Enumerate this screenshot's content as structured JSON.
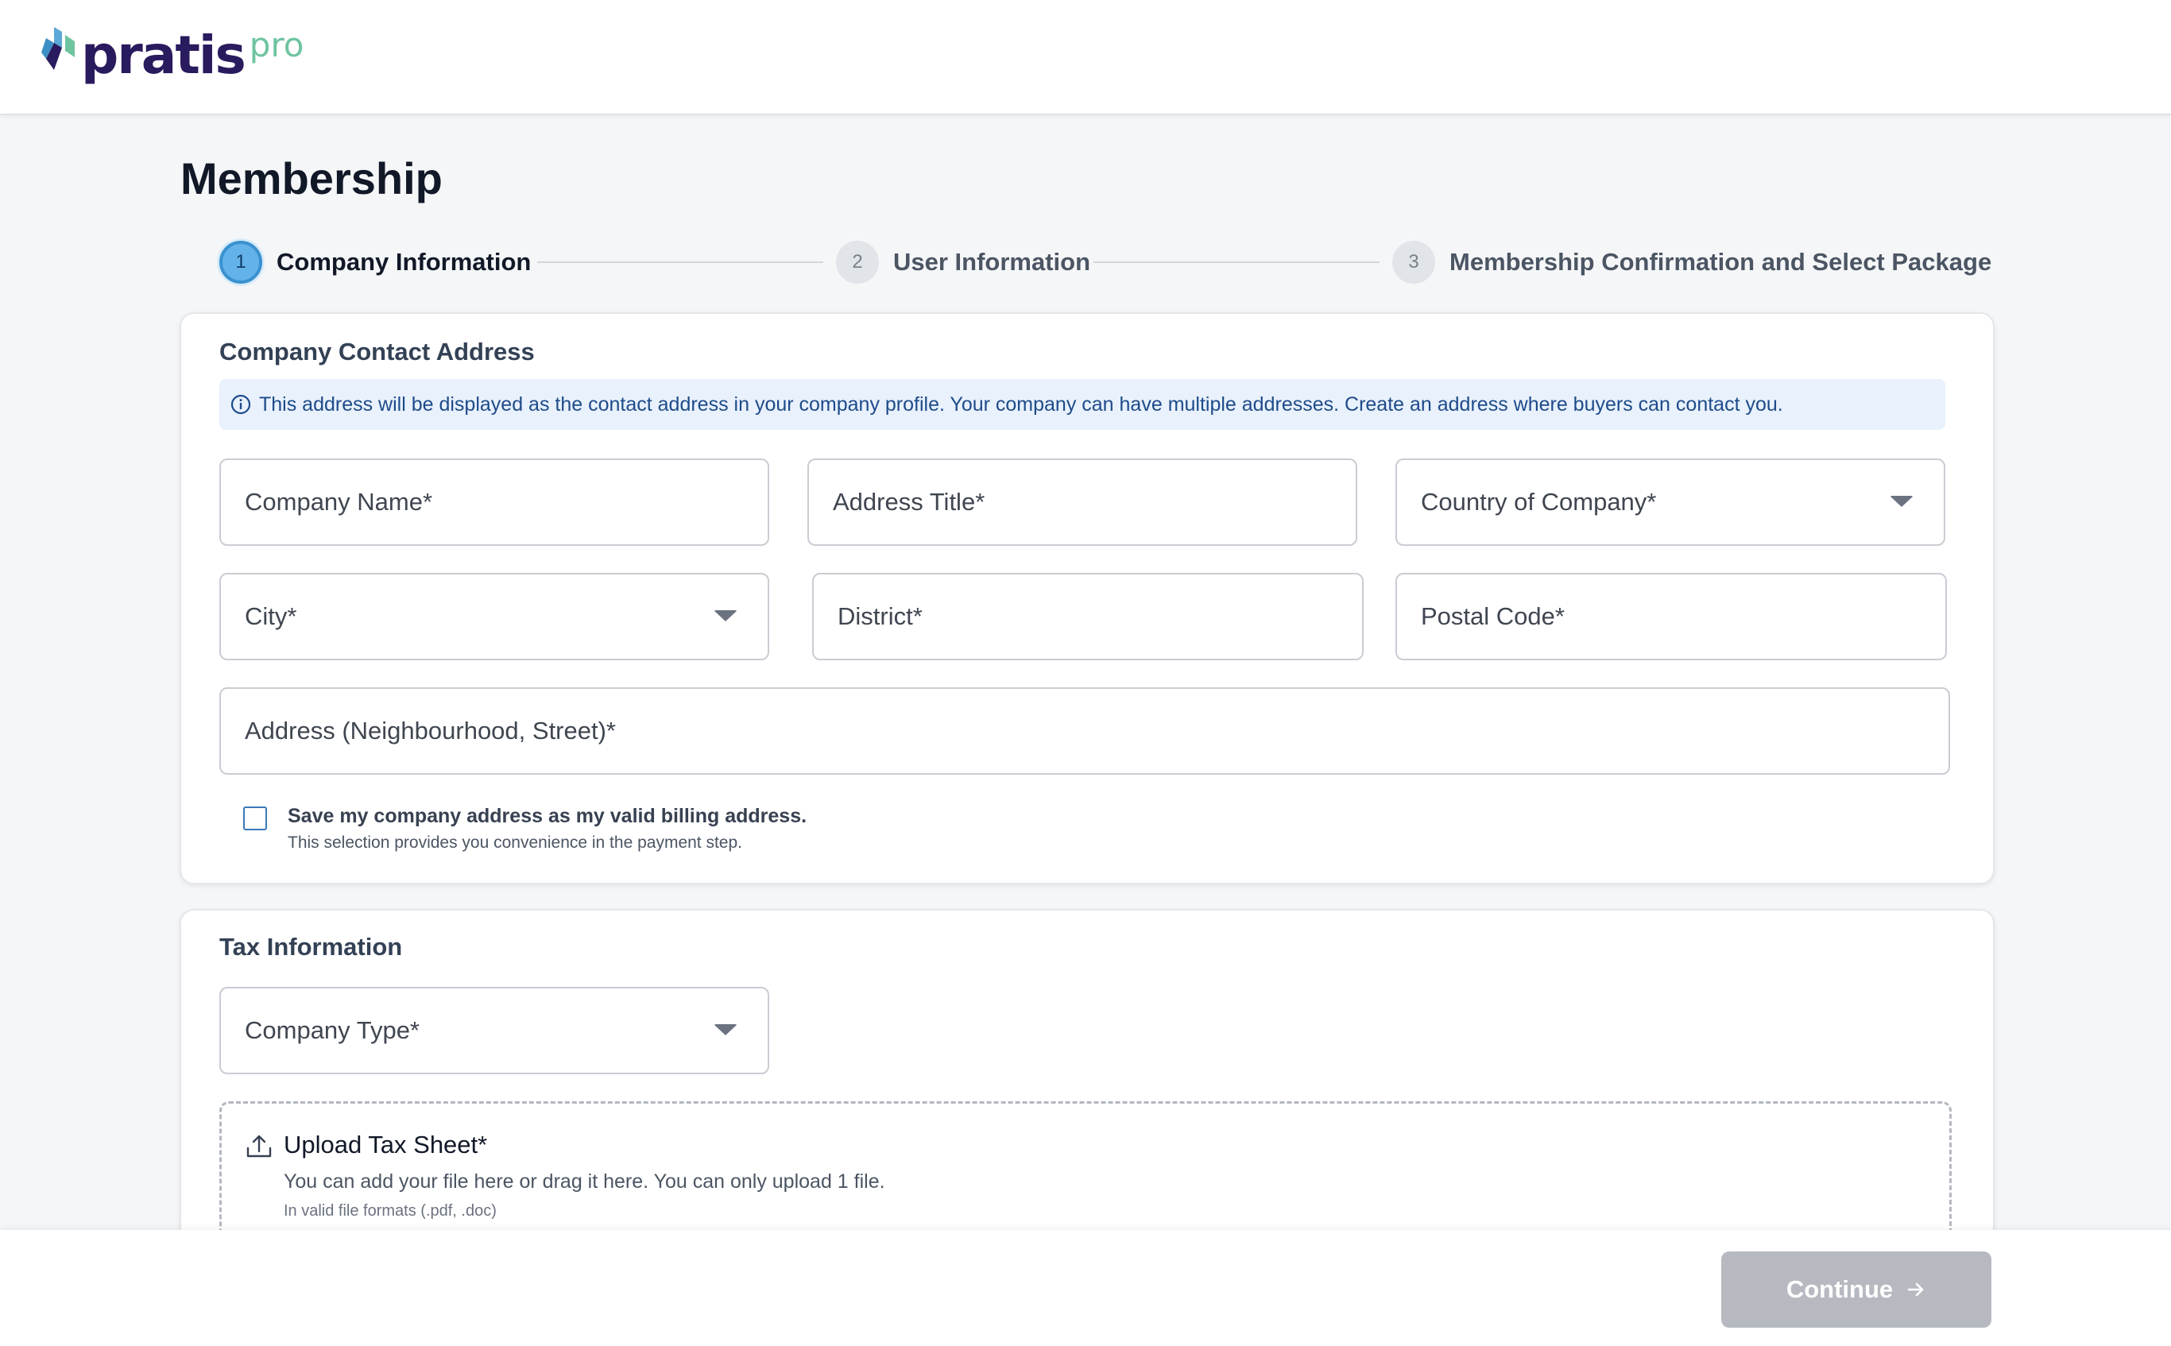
{
  "header": {
    "logo_word": "pratis",
    "logo_suffix": "pro",
    "brand_color": "#2a1a5e",
    "accent_color": "#6fc4a0"
  },
  "page": {
    "title": "Membership"
  },
  "stepper": {
    "steps": [
      {
        "number": "1",
        "label": "Company Information",
        "state": "active"
      },
      {
        "number": "2",
        "label": "User Information",
        "state": "inactive"
      },
      {
        "number": "3",
        "label": "Membership Confirmation and Select Package",
        "state": "inactive"
      }
    ]
  },
  "contact_card": {
    "title": "Company Contact Address",
    "info": "This address will be displayed as the contact address in your company profile. Your company can have multiple addresses. Create an address where buyers can contact you.",
    "fields": {
      "company_name": "Company Name*",
      "address_title": "Address Title*",
      "country": "Country of Company*",
      "city": "City*",
      "district": "District*",
      "postal_code": "Postal Code*",
      "address": "Address (Neighbourhood, Street)*"
    },
    "billing_checkbox": {
      "checked": false,
      "label": "Save my company address as my valid billing address.",
      "sublabel": "This selection provides you convenience in the payment step."
    }
  },
  "tax_card": {
    "title": "Tax Information",
    "company_type": "Company Type*",
    "upload": {
      "title": "Upload Tax Sheet*",
      "description": "You can add your file here or drag it here. You can only upload 1 file.",
      "formats": "In valid file formats (.pdf, .doc)"
    }
  },
  "footer": {
    "continue_label": "Continue",
    "continue_disabled": true
  },
  "icons": {
    "logo": "pratis-logo-icon",
    "info": "info-icon",
    "caret": "caret-down-icon",
    "upload": "upload-icon",
    "arrow": "arrow-right-icon"
  }
}
